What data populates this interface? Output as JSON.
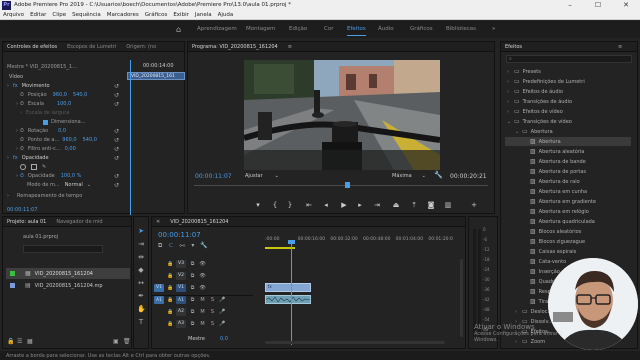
{
  "window": {
    "title": "Adobe Premiere Pro 2019 - C:\\Usuarios\\boech\\Documentos\\Adobe\\Premiere Pro\\13.0\\aula 01.prproj *",
    "logo": "Pr"
  },
  "menu": [
    "Arquivo",
    "Editar",
    "Clipe",
    "Sequência",
    "Marcadores",
    "Gráficos",
    "Exibir",
    "Janela",
    "Ajuda"
  ],
  "workspaces": [
    "Aprendizagem",
    "Montagem",
    "Edição",
    "Cor",
    "Efeitos",
    "Áudio",
    "Gráficos",
    "Bibliotecas"
  ],
  "active_workspace": "Efeitos",
  "effect_controls": {
    "tabs": [
      "Controles de efeitos",
      "Escopos de Lumetri",
      "Origem: (no"
    ],
    "master": "Mestre * VID_20200815_1...",
    "clip_name": "VID_20200815_1...",
    "clip_timecode": "00:00:14:00",
    "clip_bar_label": "VID_20200815_161",
    "section_video": "Vídeo",
    "movement": "Movimento",
    "position_label": "Posição",
    "position_x": "960,0",
    "position_y": "540,0",
    "scale_label": "Escala",
    "scale_val": "100,0",
    "scale_width_label": "Escala de largura",
    "uniform_label": "Dimensiona...",
    "rotation_label": "Rotação",
    "rotation_val": "0,0",
    "anchor_label": "Ponto de a...",
    "anchor_x": "960,0",
    "anchor_y": "540,0",
    "flicker_label": "Filtro anti-c...",
    "flicker_val": "0,00",
    "opacity_section": "Opacidade",
    "opacity_label": "Opacidade",
    "opacity_val": "100,0 %",
    "blend_label": "Modo de m...",
    "blend_val": "Normal",
    "remap_label": "Remapeamento de tempo",
    "bottom_timecode": "00:00:11:07"
  },
  "program": {
    "tab": "Programa: VID_20200815_161204",
    "timecode": "00:00:11:07",
    "fit": "Ajustar",
    "quality": "Máxima",
    "duration": "00:00:20:21",
    "playhead_fraction": 0.52
  },
  "effects_panel": {
    "title": "Efeitos",
    "search_placeholder": "",
    "items": [
      {
        "label": "Presets",
        "level": 0,
        "type": "folder"
      },
      {
        "label": "Predefinições de Lumetri",
        "level": 0,
        "type": "folder"
      },
      {
        "label": "Efeitos de áudio",
        "level": 0,
        "type": "folder"
      },
      {
        "label": "Transições de áudio",
        "level": 0,
        "type": "folder"
      },
      {
        "label": "Efeitos de vídeo",
        "level": 0,
        "type": "folder"
      },
      {
        "label": "Transições de vídeo",
        "level": 0,
        "type": "folder-open"
      },
      {
        "label": "Abertura",
        "level": 1,
        "type": "folder-open"
      },
      {
        "label": "Abertura",
        "level": 2,
        "type": "effect",
        "selected": true
      },
      {
        "label": "Abertura aleatória",
        "level": 2,
        "type": "effect"
      },
      {
        "label": "Abertura de bande",
        "level": 2,
        "type": "effect"
      },
      {
        "label": "Abertura de portas",
        "level": 2,
        "type": "effect"
      },
      {
        "label": "Abertura de raio",
        "level": 2,
        "type": "effect"
      },
      {
        "label": "Abertura em cunha",
        "level": 2,
        "type": "effect"
      },
      {
        "label": "Abertura em gradiente",
        "level": 2,
        "type": "effect"
      },
      {
        "label": "Abertura em relógio",
        "level": 2,
        "type": "effect"
      },
      {
        "label": "Abertura quadriculada",
        "level": 2,
        "type": "effect"
      },
      {
        "label": "Blocos aleatórios",
        "level": 2,
        "type": "effect"
      },
      {
        "label": "Blocos ziguezague",
        "level": 2,
        "type": "effect"
      },
      {
        "label": "Caixas espirais",
        "level": 2,
        "type": "effect"
      },
      {
        "label": "Cata-vento",
        "level": 2,
        "type": "effect"
      },
      {
        "label": "Inserção",
        "level": 2,
        "type": "effect"
      },
      {
        "label": "Quadriculado",
        "level": 2,
        "type": "effect"
      },
      {
        "label": "Respingo",
        "level": 2,
        "type": "effect"
      },
      {
        "label": "Tiras",
        "level": 2,
        "type": "effect"
      },
      {
        "label": "Desloc...",
        "level": 1,
        "type": "folder"
      },
      {
        "label": "Dissolv...",
        "level": 1,
        "type": "folder"
      },
      {
        "label": "Efeitos...",
        "level": 1,
        "type": "folder"
      },
      {
        "label": "Zoom",
        "level": 1,
        "type": "folder"
      }
    ]
  },
  "project": {
    "tabs": [
      "Projeto: aula 01",
      "Navegador de mid"
    ],
    "file": "aula 01.prproj",
    "items": [
      {
        "name": "VID_20200815_161204",
        "type": "sequence"
      },
      {
        "name": "VID_20200815_161204.mp",
        "type": "clip"
      }
    ]
  },
  "timeline": {
    "tab": "VID_20200815_161204",
    "timecode": "00:00:11:07",
    "ruler": [
      ":00:00",
      "00:00:16:00",
      "00:00:32:00",
      "00:00:48:00",
      "00:01:04:00",
      "00:01:20:0"
    ],
    "tracks": [
      {
        "name": "V3",
        "kind": "video"
      },
      {
        "name": "V2",
        "kind": "video"
      },
      {
        "name": "V1",
        "kind": "video",
        "targeted": true
      },
      {
        "name": "A1",
        "kind": "audio",
        "targeted": true
      },
      {
        "name": "A2",
        "kind": "audio"
      },
      {
        "name": "A3",
        "kind": "audio"
      }
    ],
    "master": "Mestre",
    "master_val": "0,0",
    "audio_meter_labels": [
      "0",
      "-6",
      "-12",
      "-18",
      "-24",
      "-30",
      "-36",
      "-42",
      "-48",
      "-54",
      "dB"
    ]
  },
  "status": "Arraste a borda para selecionar. Use as teclas Alt e Ctrl para obter outras opções.",
  "watermark": [
    "Ativar o Windows",
    "Acesse Configurações para ativar o Windows."
  ],
  "colors": {
    "accent": "#4a9ee8",
    "video_clip": "#84a6d2",
    "audio_clip": "#6f9fb4",
    "track_target": "#3a6ea8"
  }
}
